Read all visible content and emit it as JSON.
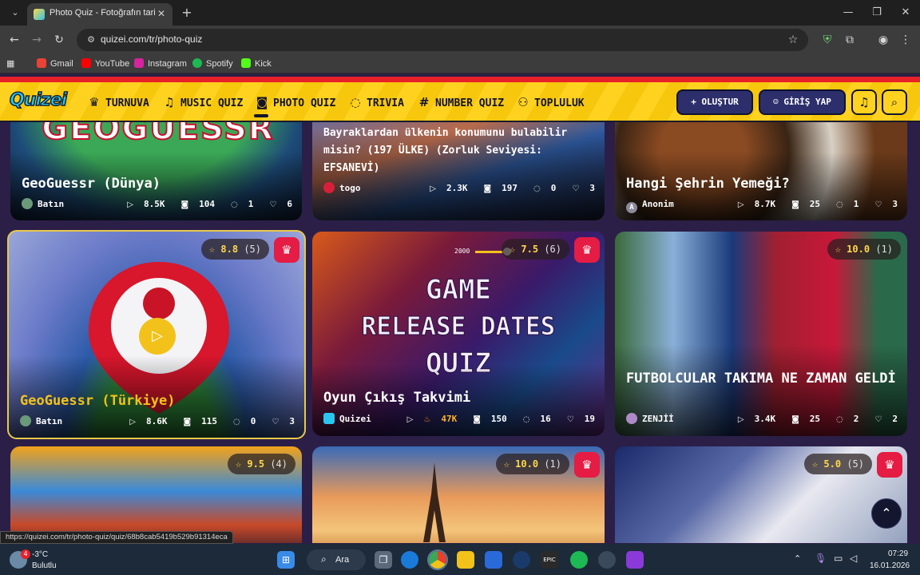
{
  "browser": {
    "tab_title": "Photo Quiz - Fotoğrafın tarihini",
    "url": "quizei.com/tr/photo-quiz",
    "bookmarks": [
      "Gmail",
      "YouTube",
      "Instagram",
      "Spotify",
      "Kick"
    ],
    "status_url": "https://quizei.com/tr/photo-quiz/quiz/68b8cab5419b529b91314eca"
  },
  "site": {
    "logo": "Quizei",
    "nav": [
      "TURNUVA",
      "MUSIC QUIZ",
      "PHOTO QUIZ",
      "TRIVIA",
      "NUMBER QUIZ",
      "TOPLULUK"
    ],
    "create_label": "OLUŞTUR",
    "login_label": "GİRİŞ YAP"
  },
  "cards": [
    {
      "title": "GeoGuessr (Dünya)",
      "banner": "GEOGUESSR",
      "author": "Batın",
      "plays": "8.5K",
      "photos": "104",
      "comments": "1",
      "likes": "6"
    },
    {
      "title": "Bayraklardan ülkenin konumunu bulabilir misin? (197 ÜLKE) (Zorluk Seviyesi: EFSANEVİ)",
      "author": "togo",
      "plays": "2.3K",
      "photos": "197",
      "comments": "0",
      "likes": "3"
    },
    {
      "title": "Hangi Şehrin Yemeği?",
      "author": "Anonim",
      "author_initial": "A",
      "plays": "8.7K",
      "photos": "25",
      "comments": "1",
      "likes": "3"
    },
    {
      "title": "GeoGuessr (Türkiye)",
      "author": "Batın",
      "rating": "8.8",
      "rating_count": "(5)",
      "plays": "8.6K",
      "photos": "115",
      "comments": "0",
      "likes": "3"
    },
    {
      "title": "Oyun Çıkış Takvimi",
      "banner": [
        "GAME",
        "RELEASE DATES",
        "QUIZ"
      ],
      "slider_value": "2000",
      "author": "Quizei",
      "rating": "7.5",
      "rating_count": "(6)",
      "plays": "47K",
      "photos": "150",
      "comments": "16",
      "likes": "19"
    },
    {
      "title": "FUTBOLCULAR TAKIMA NE ZAMAN GELDİ",
      "author": "ZENJİİ",
      "rating": "10.0",
      "rating_count": "(1)",
      "plays": "3.4K",
      "photos": "25",
      "comments": "2",
      "likes": "2"
    },
    {
      "rating": "9.5",
      "rating_count": "(4)"
    },
    {
      "rating": "10.0",
      "rating_count": "(1)"
    },
    {
      "rating": "5.0",
      "rating_count": "(5)"
    }
  ],
  "taskbar": {
    "temperature": "-3°C",
    "weather": "Bulutlu",
    "weather_badge": "4",
    "search_label": "Ara",
    "time": "07:29",
    "date": "16.01.2026"
  }
}
